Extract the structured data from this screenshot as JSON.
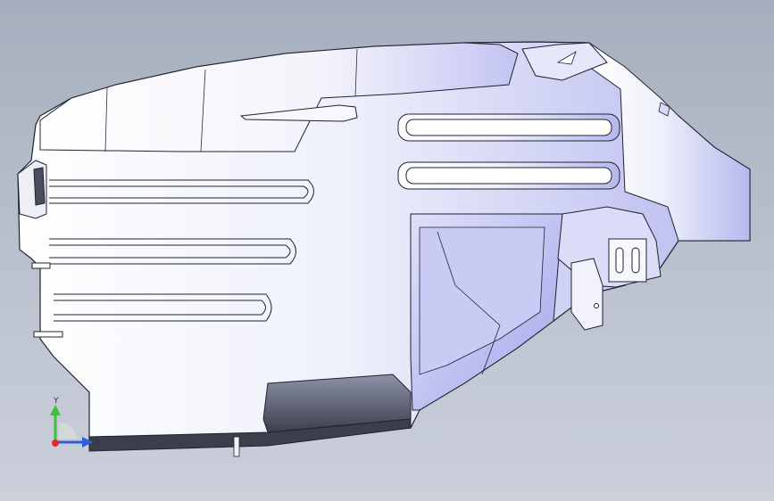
{
  "viewport": {
    "background_top": "#a6aebd",
    "background_bottom": "#cbd0db",
    "model_face_color": "#f4f5fb",
    "model_shade_color": "#b9bcf0",
    "model_edge_color": "#1f2230",
    "model_dark_color": "#3b3f4c"
  },
  "triad": {
    "y_label": "Y",
    "x_label": "X",
    "z_label": "Z",
    "y_color": "#39c23a",
    "x_color": "#e02a2a",
    "z_color": "#2f5fd8"
  }
}
